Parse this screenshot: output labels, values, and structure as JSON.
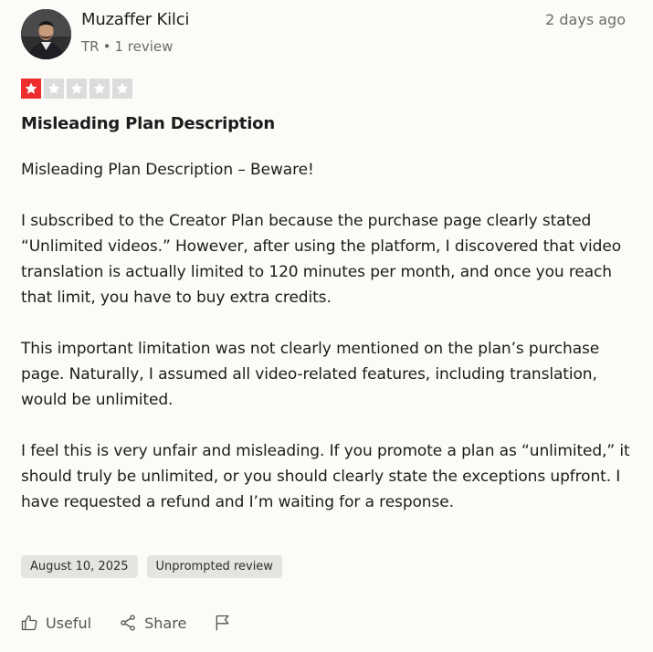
{
  "author": {
    "name": "Muzaffer Kilci",
    "country": "TR",
    "separator": "•",
    "review_count": "1 review"
  },
  "review": {
    "relative_date": "2 days ago",
    "rating": 1,
    "rating_max": 5,
    "star_color_active": "#ee2c2e",
    "star_color_inactive": "#dcdcdc",
    "title": "Misleading Plan Description",
    "paragraphs": [
      "Misleading Plan Description – Beware!",
      "I subscribed to the Creator Plan because the purchase page clearly stated “Unlimited videos.” However, after using the platform, I discovered that video translation is actually limited to 120 minutes per month, and once you reach that limit, you have to buy extra credits.",
      "This important limitation was not clearly mentioned on the plan’s purchase page. Naturally, I assumed all video-related features, including translation, would be unlimited.",
      "I feel this is very unfair and misleading. If you promote a plan as “unlimited,” it should truly be unlimited, or you should clearly state the exceptions upfront. I have requested a refund and I’m waiting for a response."
    ],
    "experience_date": "August 10, 2025",
    "review_type": "Unprompted review"
  },
  "actions": {
    "useful_label": "Useful",
    "useful_icon": "thumbs-up-icon",
    "share_label": "Share",
    "share_icon": "share-icon",
    "report_icon": "flag-icon"
  }
}
